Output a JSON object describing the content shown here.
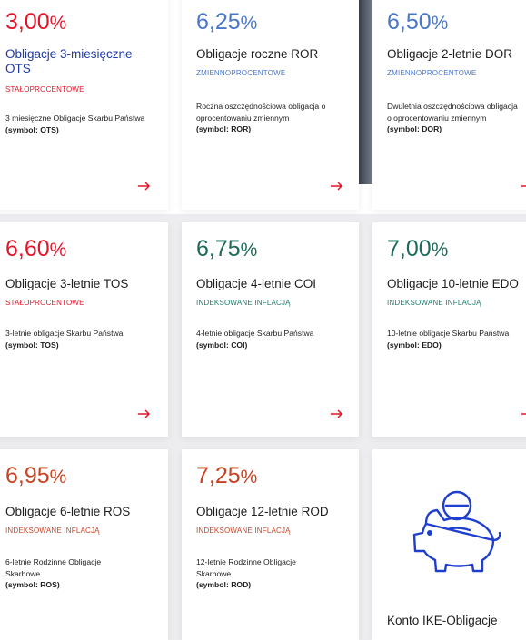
{
  "colors": {
    "red": "#e3152a",
    "blue": "#4a77c9",
    "navy_title": "#1f3aa3",
    "teal": "#1d6b5b",
    "orange": "#c84323",
    "tag_teal": "#1c7a69",
    "piggy_blue": "#1f3fd1"
  },
  "icons": {
    "arrow": "arrow-right-icon",
    "piggy": "piggy-bank-icon"
  },
  "cards": [
    {
      "rate_num": "3,00",
      "rate_pct": "%",
      "title": "Obligacje 3-miesięczne OTS",
      "tag": "STAŁOPROCENTOWE",
      "desc": "3 miesięczne Obligacje Skarbu Państwa",
      "symbol": "(symbol: OTS)"
    },
    {
      "rate_num": "6,25",
      "rate_pct": "%",
      "title": "Obligacje roczne ROR",
      "tag": "ZMIENNOPROCENTOWE",
      "desc": "Roczna oszczędnościowa obligacja o oprocentowaniu zmiennym",
      "symbol": "(symbol: ROR)"
    },
    {
      "rate_num": "6,50",
      "rate_pct": "%",
      "title": "Obligacje 2-letnie DOR",
      "tag": "ZMIENNOPROCENTOWE",
      "desc": "Dwuletnia oszczędnościowa obligacja o oprocentowaniu zmiennym",
      "symbol": "(symbol: DOR)"
    },
    {
      "rate_num": "6,60",
      "rate_pct": "%",
      "title": "Obligacje 3-letnie TOS",
      "tag": "STAŁOPROCENTOWE",
      "desc": "3-letnie obligacje Skarbu Państwa",
      "symbol": "(symbol: TOS)"
    },
    {
      "rate_num": "6,75",
      "rate_pct": "%",
      "title": "Obligacje 4-letnie COI",
      "tag": "INDEKSOWANE INFLACJĄ",
      "desc": "4-letnie obligacje Skarbu Państwa",
      "symbol": "(symbol: COI)"
    },
    {
      "rate_num": "7,00",
      "rate_pct": "%",
      "title": "Obligacje 10-letnie EDO",
      "tag": "INDEKSOWANE INFLACJĄ",
      "desc": "10-letnie obligacje Skarbu Państwa",
      "symbol": "(symbol: EDO)"
    },
    {
      "rate_num": "6,95",
      "rate_pct": "%",
      "title": "Obligacje 6-letnie ROS",
      "tag": "INDEKSOWANE INFLACJĄ",
      "desc": "6-letnie Rodzinne Obligacje Skarbowe",
      "symbol": "(symbol: ROS)"
    },
    {
      "rate_num": "7,25",
      "rate_pct": "%",
      "title": "Obligacje 12-letnie ROD",
      "tag": "INDEKSOWANE INFLACJĄ",
      "desc": "12-letnie Rodzinne Obligacje Skarbowe",
      "symbol": "(symbol: ROD)"
    }
  ],
  "ike_card": {
    "title": "Konto IKE-Obligacje"
  }
}
